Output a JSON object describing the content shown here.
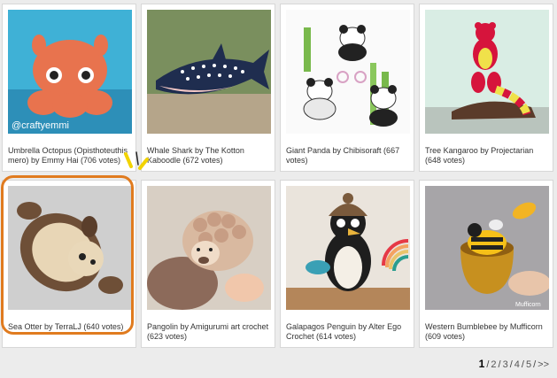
{
  "gallery": {
    "items": [
      {
        "caption": "Umbrella Octopus (Opisthoteuthis mero) by Emmy Hai (706 votes)",
        "watermark": "@craftyemmi"
      },
      {
        "caption": "Whale Shark by The Kotton Kaboodle (672 votes)"
      },
      {
        "caption": "Giant Panda by Chibisoraft (667 votes)"
      },
      {
        "caption": "Tree Kangaroo by Projectarian (648 votes)"
      },
      {
        "caption": "Sea Otter by TerraLJ (640 votes)"
      },
      {
        "caption": "Pangolin by Amigurumi art crochet (623 votes)"
      },
      {
        "caption": "Galapagos Penguin by Alter Ego Crochet (614 votes)"
      },
      {
        "caption": "Western Bumblebee by Mufficorn (609 votes)",
        "watermark": "Mufficorn"
      }
    ]
  },
  "pagination": {
    "current": "1",
    "pages": [
      "2",
      "3",
      "4",
      "5"
    ],
    "next": ">>",
    "separator": "/"
  },
  "colors": {
    "highlight": "#e07b1f",
    "spark": "#f2d300"
  }
}
